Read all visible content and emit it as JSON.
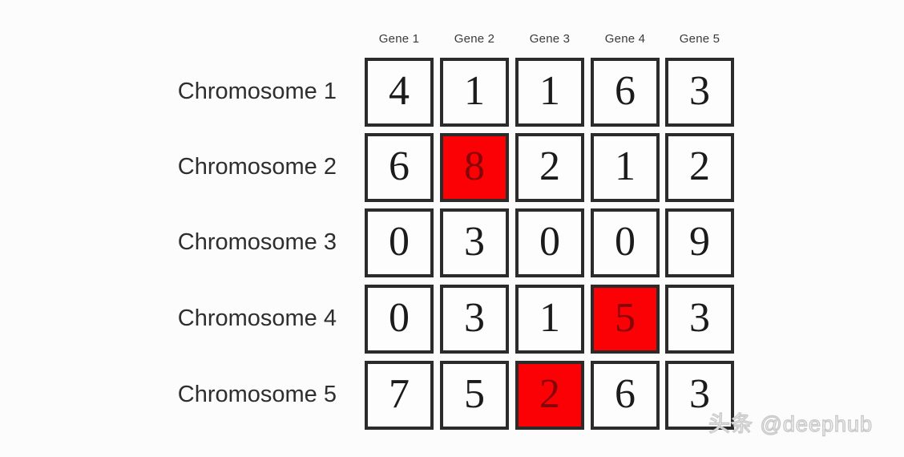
{
  "figure": {
    "kind": "gene-chromosome-matrix",
    "background_color": "#fcfcfc",
    "cell_border_color": "#2b2b2b",
    "highlight_color": "#fb0005"
  },
  "column_headers": [
    {
      "label": "Gene 1"
    },
    {
      "label": "Gene 2"
    },
    {
      "label": "Gene 3"
    },
    {
      "label": "Gene 4"
    },
    {
      "label": "Gene 5"
    }
  ],
  "row_labels": [
    {
      "label": "Chromosome 1"
    },
    {
      "label": "Chromosome 2"
    },
    {
      "label": "Chromosome 3"
    },
    {
      "label": "Chromosome 4"
    },
    {
      "label": "Chromosome 5"
    }
  ],
  "grid": {
    "rows": 5,
    "columns": 5,
    "cells": [
      [
        {
          "value": "4",
          "highlighted": false
        },
        {
          "value": "1",
          "highlighted": false
        },
        {
          "value": "1",
          "highlighted": false
        },
        {
          "value": "6",
          "highlighted": false
        },
        {
          "value": "3",
          "highlighted": false
        }
      ],
      [
        {
          "value": "6",
          "highlighted": false
        },
        {
          "value": "8",
          "highlighted": true
        },
        {
          "value": "2",
          "highlighted": false
        },
        {
          "value": "1",
          "highlighted": false
        },
        {
          "value": "2",
          "highlighted": false
        }
      ],
      [
        {
          "value": "0",
          "highlighted": false
        },
        {
          "value": "3",
          "highlighted": false
        },
        {
          "value": "0",
          "highlighted": false
        },
        {
          "value": "0",
          "highlighted": false
        },
        {
          "value": "9",
          "highlighted": false
        }
      ],
      [
        {
          "value": "0",
          "highlighted": false
        },
        {
          "value": "3",
          "highlighted": false
        },
        {
          "value": "1",
          "highlighted": false
        },
        {
          "value": "5",
          "highlighted": true
        },
        {
          "value": "3",
          "highlighted": false
        }
      ],
      [
        {
          "value": "7",
          "highlighted": false
        },
        {
          "value": "5",
          "highlighted": false
        },
        {
          "value": "2",
          "highlighted": true
        },
        {
          "value": "6",
          "highlighted": false
        },
        {
          "value": "3",
          "highlighted": false
        }
      ]
    ]
  },
  "watermark": {
    "text": "头条 @deephub"
  }
}
